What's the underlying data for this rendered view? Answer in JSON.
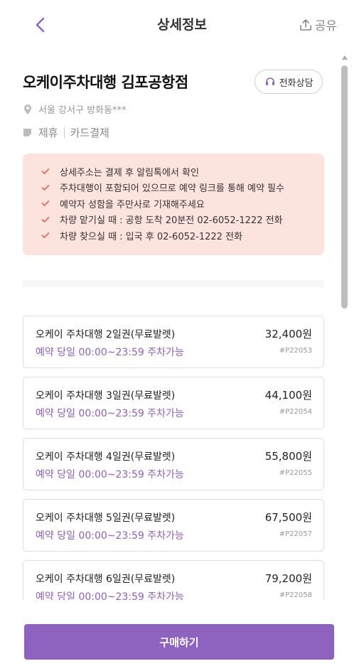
{
  "header": {
    "title": "상세정보",
    "share_label": "공유"
  },
  "store": {
    "name": "오케이주차대행 김포공항점",
    "call_label": "전화상담",
    "address": "서울 강서구 방화동***",
    "tags": [
      "제휴",
      "카드결제"
    ]
  },
  "notices": [
    "상세주소는 결제 후 알림톡에서 확인",
    "주차대행이 포함되어 있으므로 예약 링크를 통해 예약 필수",
    "예약자 성함을 주만사로 기재해주세요",
    "차량 맡기실 때 : 공항 도착 20분전 02-6052-1222 전화",
    "차량 찾으실 때 : 입국 후 02-6052-1222 전화"
  ],
  "products": [
    {
      "name": "오케이 주차대행 2일권(무료발렛)",
      "time": "예약 당일 00:00~23:59 주차가능",
      "price": "32,400원",
      "code": "#P22053"
    },
    {
      "name": "오케이 주차대행 3일권(무료발렛)",
      "time": "예약 당일 00:00~23:59 주차가능",
      "price": "44,100원",
      "code": "#P22054"
    },
    {
      "name": "오케이 주차대행 4일권(무료발렛)",
      "time": "예약 당일 00:00~23:59 주차가능",
      "price": "55,800원",
      "code": "#P22055"
    },
    {
      "name": "오케이 주차대행 5일권(무료발렛)",
      "time": "예약 당일 00:00~23:59 주차가능",
      "price": "67,500원",
      "code": "#P22057"
    },
    {
      "name": "오케이 주차대행 6일권(무료발렛)",
      "time": "예약 당일 00:00~23:59 주차가능",
      "price": "79,200원",
      "code": "#P22058"
    }
  ],
  "footer": {
    "buy_label": "구매하기"
  },
  "icons": {
    "back": "chevron-left-icon",
    "share": "share-upload-icon",
    "call": "headset-icon",
    "address": "location-pin-icon",
    "tags": "tag-icon",
    "notice": "check-icon"
  },
  "colors": {
    "accent": "#8e62bf",
    "notice_bg": "#fde3de",
    "check": "#e0675a"
  }
}
